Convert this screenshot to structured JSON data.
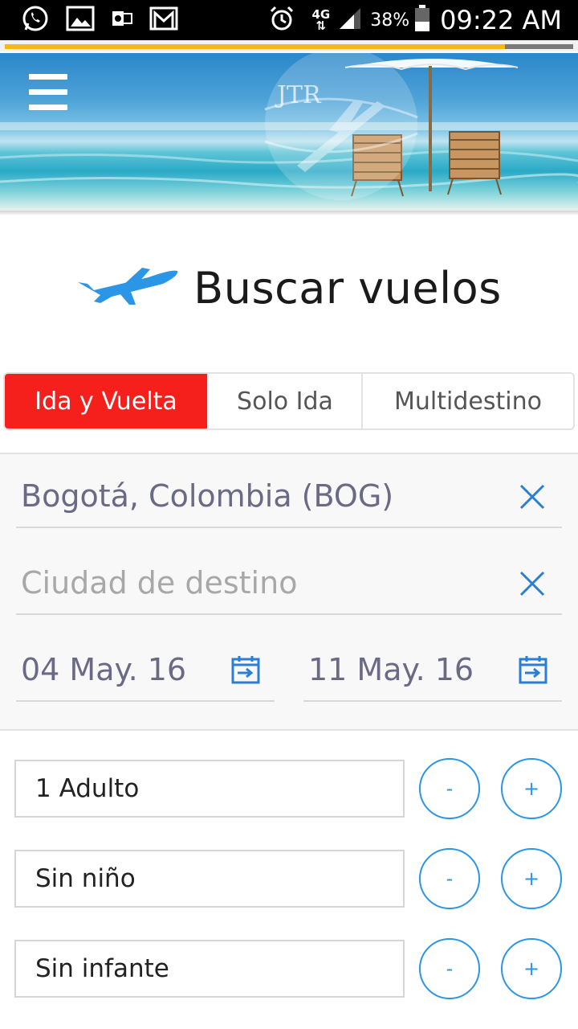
{
  "status_bar": {
    "left_icons": [
      "whatsapp-icon",
      "gallery-icon",
      "outlook-icon",
      "gmail-icon"
    ],
    "network": "4G",
    "battery_percent": "38%",
    "time": "09:22 AM"
  },
  "loading": {
    "progress": 0.88,
    "color": "#f5b817"
  },
  "hero": {
    "logo_text": "JTR"
  },
  "title": "Buscar vuelos",
  "tabs": [
    {
      "label": "Ida y Vuelta",
      "active": true
    },
    {
      "label": "Solo Ida",
      "active": false
    },
    {
      "label": "Multidestino",
      "active": false
    }
  ],
  "form": {
    "origin": "Bogotá, Colombia (BOG)",
    "destination_placeholder": "Ciudad de destino",
    "depart_date": "04 May. 16",
    "return_date": "11 May. 16"
  },
  "passengers": [
    {
      "label": "1 Adulto",
      "minus": "-",
      "plus": "+"
    },
    {
      "label": "Sin niño",
      "minus": "-",
      "plus": "+"
    },
    {
      "label": "Sin infante",
      "minus": "-",
      "plus": "+"
    }
  ],
  "colors": {
    "accent_red": "#f5201c",
    "accent_blue": "#2b95e6",
    "field_text": "#6b6a86"
  }
}
